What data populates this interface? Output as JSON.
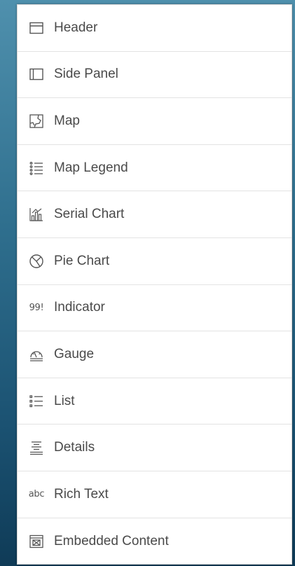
{
  "widget_menu": {
    "items": [
      {
        "label": "Header",
        "icon": "header-icon"
      },
      {
        "label": "Side Panel",
        "icon": "side-panel-icon"
      },
      {
        "label": "Map",
        "icon": "map-icon"
      },
      {
        "label": "Map Legend",
        "icon": "map-legend-icon"
      },
      {
        "label": "Serial Chart",
        "icon": "serial-chart-icon"
      },
      {
        "label": "Pie Chart",
        "icon": "pie-chart-icon"
      },
      {
        "label": "Indicator",
        "icon": "indicator-icon",
        "icon_text": "99!"
      },
      {
        "label": "Gauge",
        "icon": "gauge-icon"
      },
      {
        "label": "List",
        "icon": "list-icon"
      },
      {
        "label": "Details",
        "icon": "details-icon"
      },
      {
        "label": "Rich Text",
        "icon": "rich-text-icon",
        "icon_text": "abc"
      },
      {
        "label": "Embedded Content",
        "icon": "embedded-content-icon"
      }
    ]
  }
}
